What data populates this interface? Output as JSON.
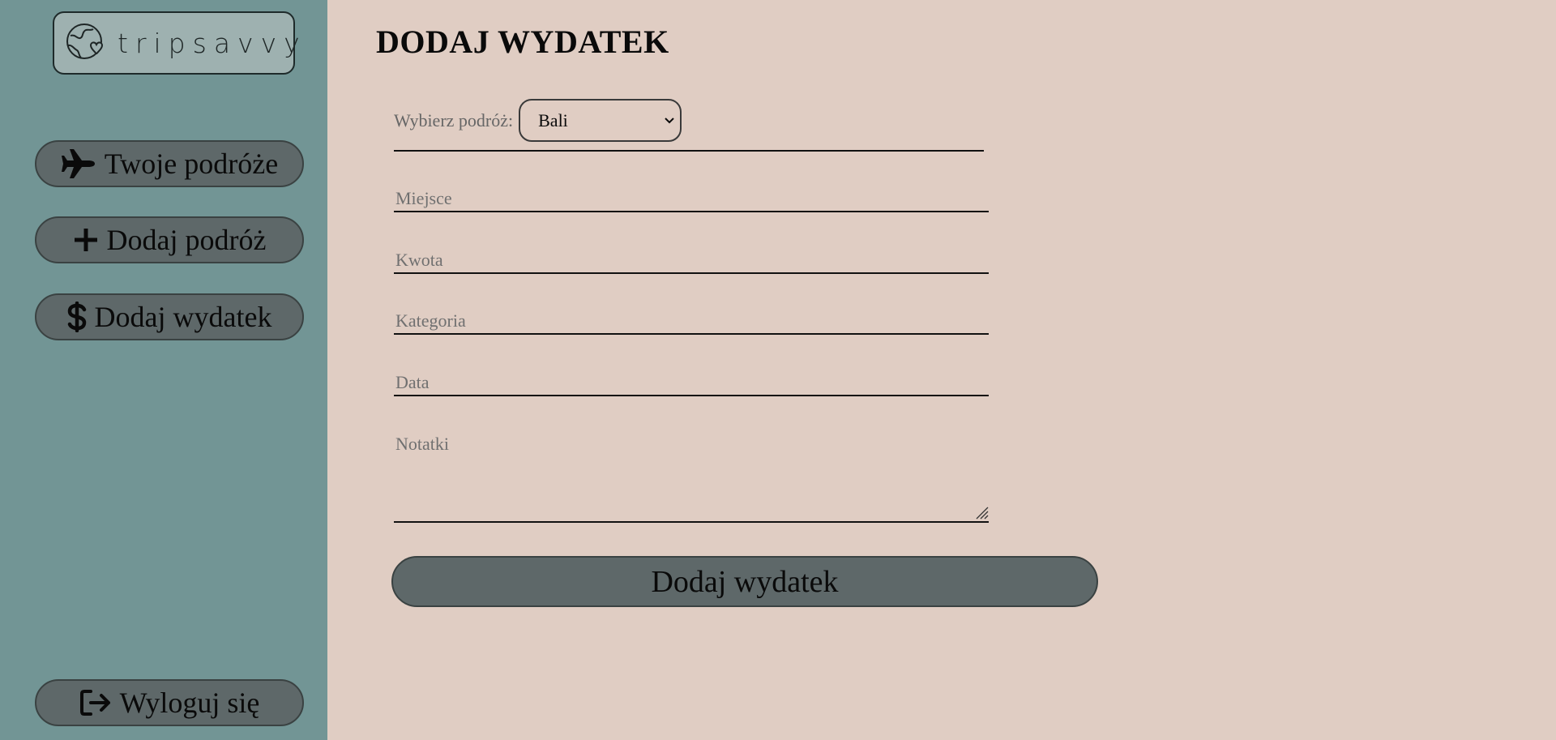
{
  "brand": {
    "name": "tripsavvy",
    "icon": "globe-heart-icon"
  },
  "sidebar": {
    "items": [
      {
        "label": "Twoje podróże",
        "icon": "plane-icon"
      },
      {
        "label": "Dodaj podróż",
        "icon": "plus-icon"
      },
      {
        "label": "Dodaj wydatek",
        "icon": "dollar-icon"
      }
    ],
    "logout": {
      "label": "Wyloguj się",
      "icon": "logout-icon"
    }
  },
  "page": {
    "title": "DODAJ WYDATEK"
  },
  "form": {
    "trip_label": "Wybierz podróż:",
    "trip_selected": "Bali",
    "place_placeholder": "Miejsce",
    "amount_placeholder": "Kwota",
    "category_placeholder": "Kategoria",
    "date_placeholder": "Data",
    "notes_placeholder": "Notatki",
    "submit_label": "Dodaj wydatek"
  },
  "colors": {
    "sidebar_bg": "#729595",
    "main_bg": "#e0cdc3",
    "button_bg": "#5e6869",
    "logo_bg": "#9eb1b0"
  }
}
